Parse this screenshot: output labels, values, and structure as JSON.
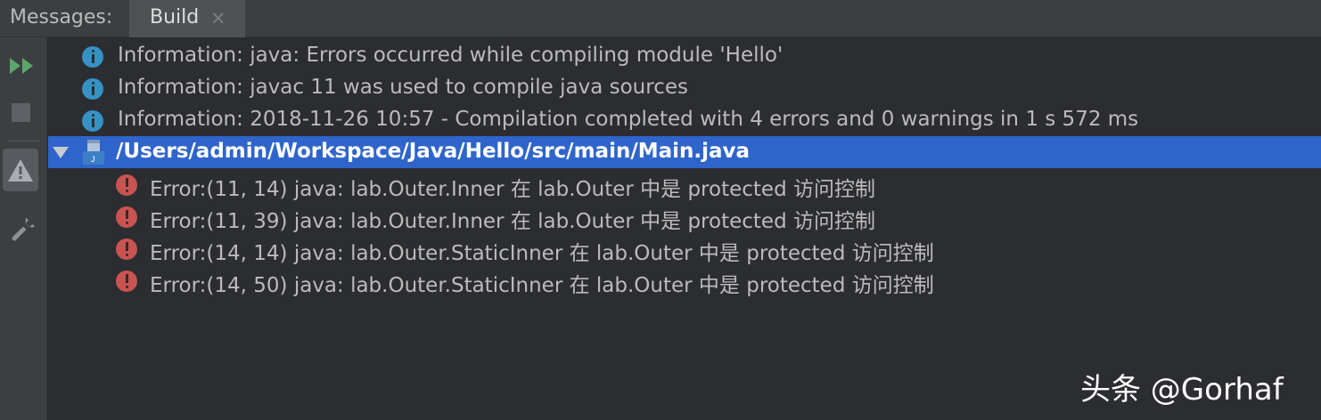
{
  "header": {
    "title": "Messages:",
    "tab_label": "Build",
    "tab_close": "×"
  },
  "toolbar": {
    "rerun_icon": "rerun-icon",
    "stop_icon": "stop-icon",
    "warning_filter_icon": "warning-icon",
    "settings_icon": "wrench-icon"
  },
  "messages": {
    "info": [
      "Information: java: Errors occurred while compiling module 'Hello'",
      "Information: javac 11 was used to compile java sources",
      "Information: 2018-11-26 10:57 - Compilation completed with 4 errors and 0 warnings in 1 s 572 ms"
    ],
    "file": {
      "path": "/Users/admin/Workspace/Java/Hello/src/main/Main.java",
      "expanded": true
    },
    "errors": [
      "Error:(11, 14)  java: lab.Outer.Inner 在 lab.Outer 中是 protected 访问控制",
      "Error:(11, 39)  java: lab.Outer.Inner 在 lab.Outer 中是 protected 访问控制",
      "Error:(14, 14)  java: lab.Outer.StaticInner 在 lab.Outer 中是 protected 访问控制",
      "Error:(14, 50)  java: lab.Outer.StaticInner 在 lab.Outer 中是 protected 访问控制"
    ]
  },
  "watermark": "头条 @Gorhaf",
  "colors": {
    "selection": "#2f65ca",
    "info_icon": "#3592c4",
    "error_icon": "#c75450",
    "run_green": "#59a869"
  }
}
